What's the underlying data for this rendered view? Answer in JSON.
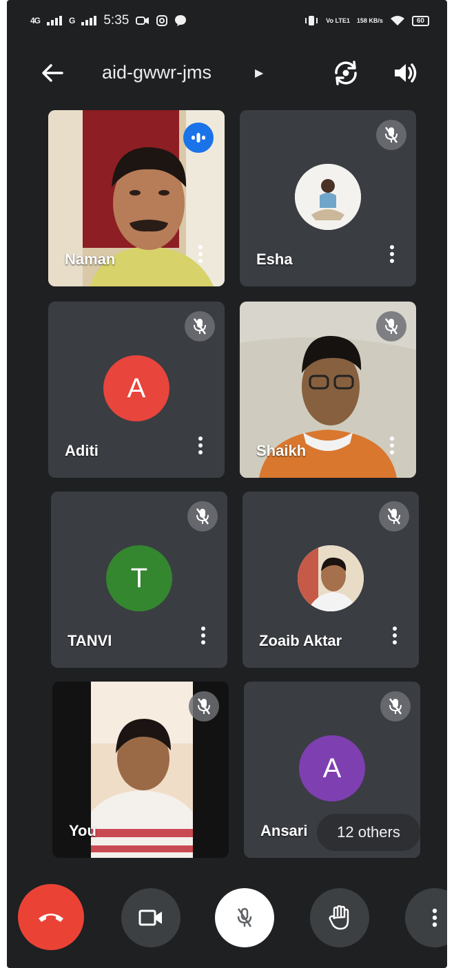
{
  "status_bar": {
    "sim1": "4G",
    "sim2": "G",
    "time": "5:35",
    "volte": "Vo\nLTE1",
    "speed": "158\nKB/s",
    "battery": "60"
  },
  "meeting": {
    "code": "aid-gwwr-jms"
  },
  "participants": [
    {
      "name": "Naman",
      "state": "speaking",
      "view": "video"
    },
    {
      "name": "Esha",
      "state": "muted",
      "view": "photo-avatar"
    },
    {
      "name": "Aditi",
      "state": "muted",
      "view": "letter-avatar",
      "initial": "A",
      "color": "#e8453c"
    },
    {
      "name": "Shaikh",
      "state": "muted",
      "view": "video"
    },
    {
      "name": "TANVI",
      "state": "muted",
      "view": "letter-avatar",
      "initial": "T",
      "color": "#34862f"
    },
    {
      "name": "Zoaib Aktar",
      "state": "muted",
      "view": "photo-avatar"
    },
    {
      "name": "You",
      "state": "muted",
      "view": "video"
    },
    {
      "name": "Ansari",
      "state": "muted",
      "view": "letter-avatar",
      "initial": "A",
      "color": "#7e3fb0"
    }
  ],
  "others_label": "12 others",
  "controls": {
    "end_call_color": "#ea4335",
    "mic_muted_bg": "#ffffff",
    "button_bg": "#3c4043"
  }
}
